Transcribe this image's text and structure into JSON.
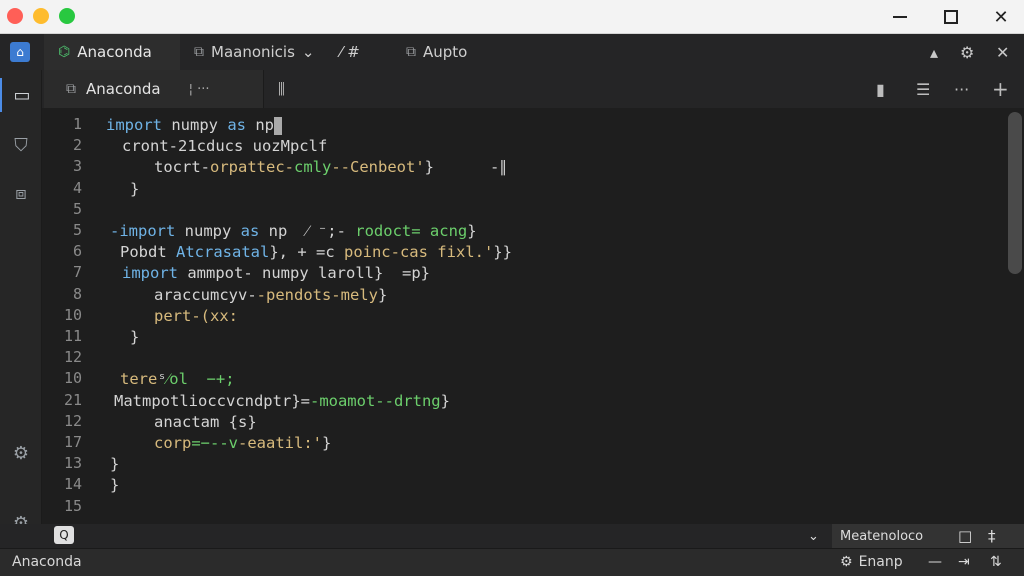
{
  "colors": {
    "editor_bg": "#1e1e1e",
    "keyword": "#6fb3e6",
    "string": "#d7ba7d",
    "green": "#6ccf6c",
    "text": "#d4d4d4",
    "accent": "#4c8ce6"
  },
  "titlebar": {
    "icons": [
      "close-dot",
      "minimize-dot",
      "zoom-dot"
    ],
    "controls": {
      "minimize": "—",
      "maximize": "□",
      "close": "✕"
    }
  },
  "tabs": [
    {
      "label": "Anaconda",
      "icon": "branch-icon"
    },
    {
      "label": "Maanonicis",
      "icon": "puzzle-icon",
      "arrow": "⌄"
    },
    {
      "label": "⁄ #",
      "icon": "wrench-icon"
    },
    {
      "label": "Aupto",
      "icon": "puzzle-icon"
    }
  ],
  "top_right": {
    "user": "▴",
    "settings": "⚙",
    "close": "✕"
  },
  "activity": [
    "chat-icon",
    "shield-icon",
    "extensions-icon",
    "settings-icon",
    "gear-icon"
  ],
  "editor_tab": {
    "label": "Anaconda",
    "extra": "¦ ···",
    "split": "⫼"
  },
  "editor_right": {
    "bookmark": "▮",
    "list": "☰",
    "more": "···",
    "add": "+"
  },
  "line_numbers": [
    "1",
    "2",
    "3",
    "4",
    "5",
    "5",
    "6",
    "7",
    "8",
    "10",
    "11",
    "12",
    "10",
    "21",
    "12",
    "17",
    "13",
    "14",
    "15"
  ],
  "code_lines": [
    {
      "segs": [
        [
          "import",
          "kw"
        ],
        [
          " numpy ",
          "tx"
        ],
        [
          "as",
          "kw"
        ],
        [
          " np",
          "tx"
        ]
      ],
      "cursor": true
    },
    {
      "indent": 16,
      "segs": [
        [
          "cront-21cducs uozMpclf",
          "tx"
        ]
      ]
    },
    {
      "indent": 48,
      "segs": [
        [
          "tocrt-",
          "tx"
        ],
        [
          "orpattec-",
          "st"
        ],
        [
          "cmly",
          "gr"
        ],
        [
          "--Cenbeot'",
          "st"
        ],
        [
          "}      -∥",
          "tx"
        ]
      ]
    },
    {
      "indent": 24,
      "segs": [
        [
          "}",
          "tx"
        ]
      ]
    },
    {
      "indent": 0,
      "segs": []
    },
    {
      "indent": 4,
      "segs": [
        [
          "-import",
          "kw"
        ],
        [
          " numpy ",
          "tx"
        ],
        [
          "as",
          "kw"
        ],
        [
          " np  ",
          "tx"
        ],
        [
          "⁄ ⁻;- ",
          "tx"
        ],
        [
          "rodoct= acng",
          "gr"
        ],
        [
          "}",
          "tx"
        ]
      ]
    },
    {
      "indent": 14,
      "segs": [
        [
          "Pobdt ",
          "tx"
        ],
        [
          "Atcrasatal",
          "kw"
        ],
        [
          "}, + =c ",
          "tx"
        ],
        [
          "poinc-cas fixl.'",
          "st"
        ],
        [
          "}}",
          "tx"
        ]
      ]
    },
    {
      "indent": 16,
      "segs": [
        [
          "import",
          "kw"
        ],
        [
          " ammpot- ",
          "tx"
        ],
        [
          "numpy ",
          "tx"
        ],
        [
          "laroll",
          "tx"
        ],
        [
          "}  =p}",
          "tx"
        ]
      ]
    },
    {
      "indent": 48,
      "segs": [
        [
          "araccumcyv-",
          "tx"
        ],
        [
          "-pendots-mely",
          "st"
        ],
        [
          "}",
          "tx"
        ]
      ]
    },
    {
      "indent": 48,
      "segs": [
        [
          "pert-(xx:",
          "st"
        ]
      ]
    },
    {
      "indent": 24,
      "segs": [
        [
          "}",
          "tx"
        ]
      ]
    },
    {
      "indent": 0,
      "segs": []
    },
    {
      "indent": 14,
      "segs": [
        [
          "tere",
          "st"
        ],
        [
          "ˢ",
          "tx"
        ],
        [
          "⁄ol  −+;",
          "gr"
        ]
      ]
    },
    {
      "indent": 8,
      "segs": [
        [
          "Matmpotlioccvcndptr",
          "tx"
        ],
        [
          "}=",
          "tx"
        ],
        [
          "-moamot--drtng",
          "gr"
        ],
        [
          "}",
          "tx"
        ]
      ]
    },
    {
      "indent": 48,
      "segs": [
        [
          "anactam {s",
          "tx"
        ],
        [
          "}",
          "tx"
        ]
      ]
    },
    {
      "indent": 48,
      "segs": [
        [
          "corp",
          "st"
        ],
        [
          "=−--v",
          "gr"
        ],
        [
          "-eaatil:'",
          "st"
        ],
        [
          "}",
          "tx"
        ]
      ]
    },
    {
      "indent": 4,
      "segs": [
        [
          "}",
          "tx"
        ]
      ]
    },
    {
      "indent": 4,
      "segs": [
        [
          "}",
          "tx"
        ]
      ]
    },
    {
      "indent": 0,
      "segs": []
    }
  ],
  "status_bar_top": {
    "search": "Q",
    "collapse": "⌄",
    "label": "Meatenoloco",
    "icons": [
      "□",
      "‡"
    ]
  },
  "status_bar_bottom": {
    "left": "Anaconda",
    "right_label": "Enanp",
    "icons": [
      "—",
      "⇥",
      "⇅"
    ]
  }
}
